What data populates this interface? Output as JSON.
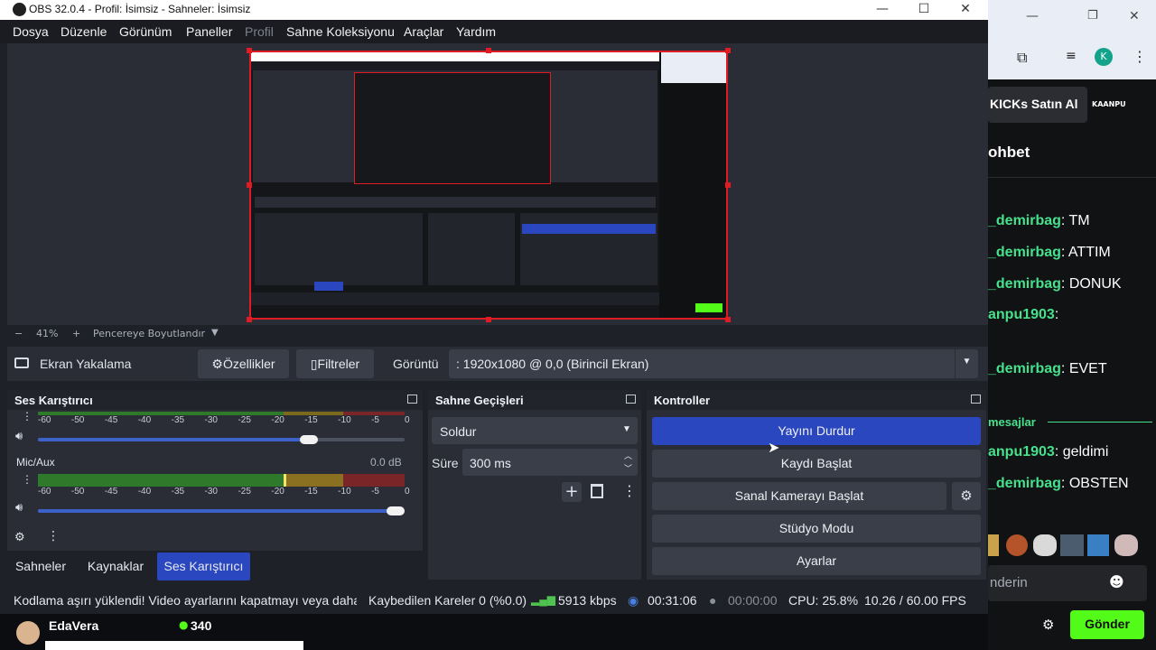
{
  "window": {
    "title": "OBS 32.0.4 - Profil: İsimsiz - Sahneler: İsimsiz"
  },
  "menu": [
    "Dosya",
    "Düzenle",
    "Görünüm",
    "Paneller",
    "Profil",
    "Sahne Koleksiyonu",
    "Araçlar",
    "Yardım"
  ],
  "zoom": {
    "minus": "−",
    "value": "41%",
    "plus": "+",
    "resize_label": "Pencereye Boyutlandır",
    "dropdown": "▼"
  },
  "source": {
    "name": "Ekran Yakalama",
    "properties_label": "Özellikler",
    "filters_label": "Filtreler",
    "display_label": "Görüntü",
    "display_value": ": 1920x1080 @ 0,0 (Birincil Ekran)"
  },
  "mixer": {
    "title": "Ses Karıştırıcı",
    "ticks": [
      "-60",
      "-50",
      "-45",
      "-40",
      "-35",
      "-30",
      "-25",
      "-20",
      "-15",
      "-10",
      "-5",
      "0"
    ],
    "channel2_name": "Mic/Aux",
    "channel2_db": "0.0 dB",
    "channel1_volume": 0.74,
    "channel2_volume": 1.0
  },
  "transitions": {
    "title": "Sahne Geçişleri",
    "selected": "Soldur",
    "duration_label": "Süre",
    "duration_value": "300 ms"
  },
  "controls": {
    "title": "Kontroller",
    "stop_stream": "Yayını Durdur",
    "start_record": "Kaydı Başlat",
    "start_virtualcam": "Sanal Kamerayı Başlat",
    "studio_mode": "Stüdyo Modu",
    "settings": "Ayarlar"
  },
  "tabs": [
    "Sahneler",
    "Kaynaklar",
    "Ses Karıştırıcı"
  ],
  "status": {
    "message": "Kodlama aşırı yüklendi! Video ayarlarını kapatmayı veya daha h",
    "dropped": "Kaybedilen Kareler 0 (%0.0)",
    "bitrate": "5913 kbps",
    "stream_time": "00:31:06",
    "record_time": "00:00:00",
    "cpu": "CPU: 25.8%",
    "fps": "10.26 / 60.00 FPS"
  },
  "taskbar": {
    "user": "EdaVera",
    "viewers": "340"
  },
  "browser": {
    "banner": "KICKs Satın Al",
    "badge": "KAANPU",
    "chat_title": "ohbet",
    "messages": [
      {
        "user": "_demirbag",
        "text": ": TM"
      },
      {
        "user": "_demirbag",
        "text": ": ATTIM"
      },
      {
        "user": "_demirbag",
        "text": ": DONUK"
      },
      {
        "user": "anpu1903",
        "text": ":"
      },
      {
        "user": "_demirbag",
        "text": ": EVET"
      },
      {
        "user": "anpu1903",
        "text": ": geldimi"
      },
      {
        "user": "_demirbag",
        "text": ": OBSTEN"
      }
    ],
    "divider": "mesajlar",
    "input_placeholder": "nderin",
    "send": "Gönder",
    "avatar_letter": "K"
  },
  "colors": {
    "accent": "#2b47c0",
    "selection": "#e01b24",
    "username": "#47e08c",
    "send": "#53fc18"
  }
}
